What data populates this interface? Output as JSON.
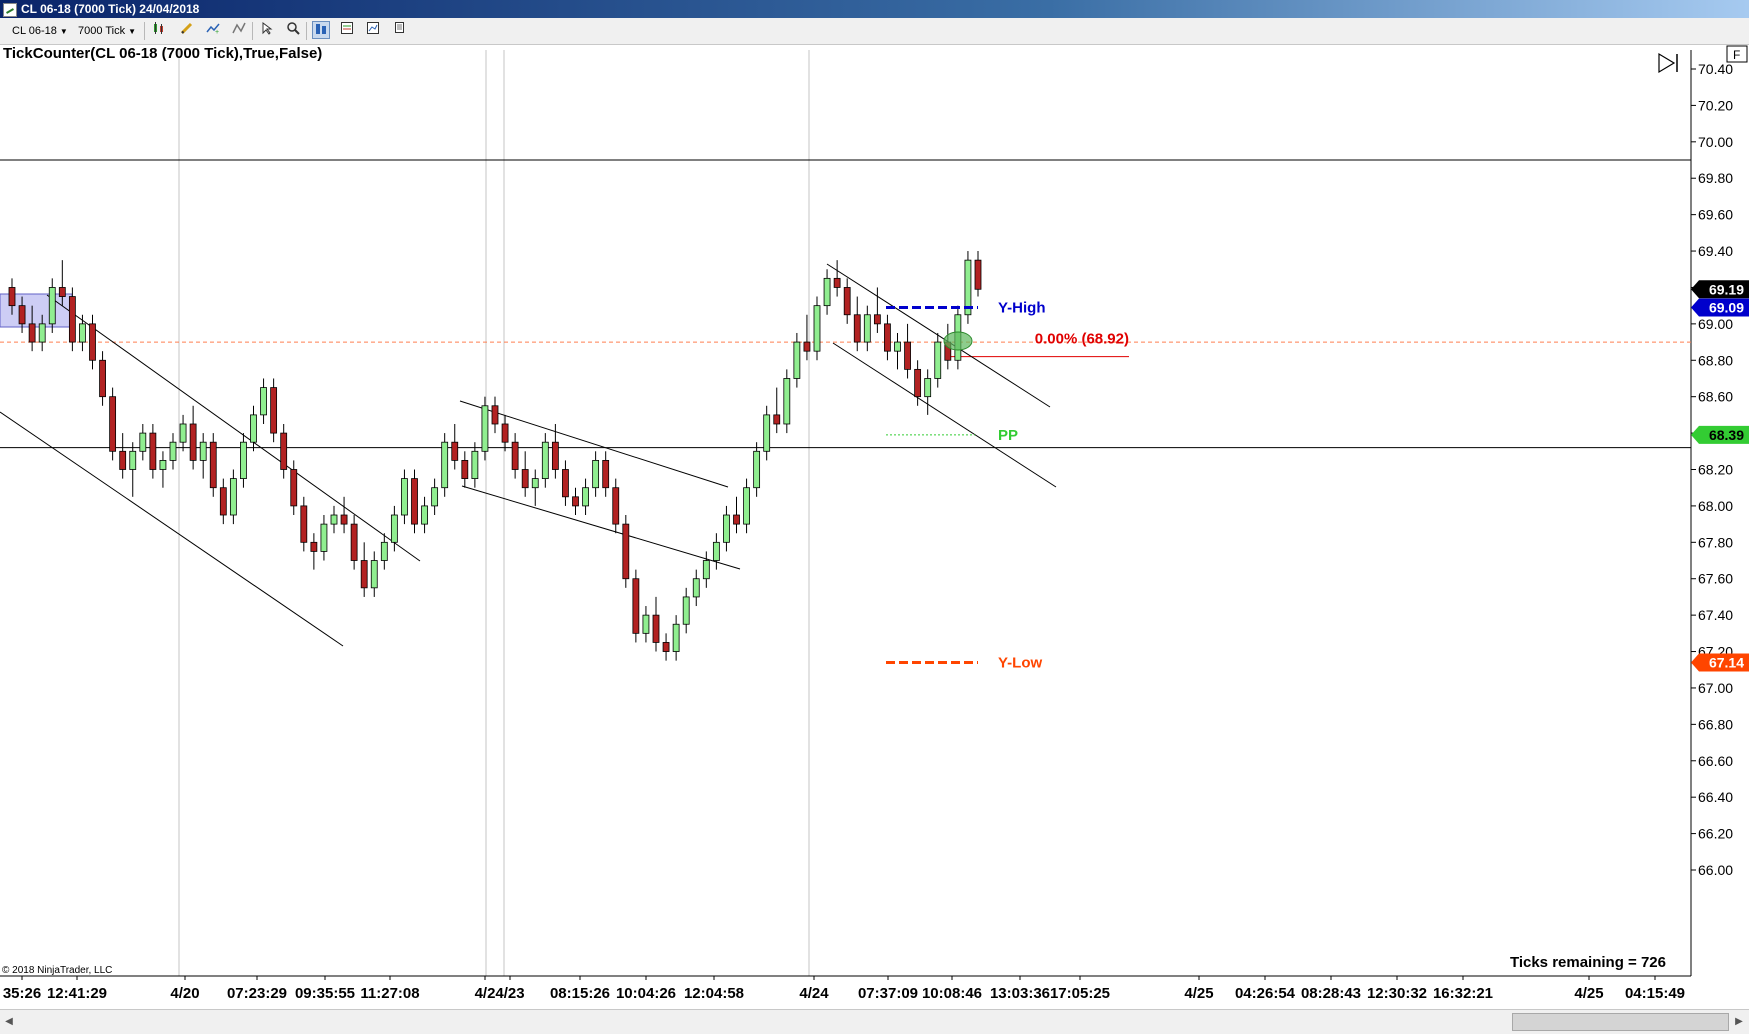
{
  "window": {
    "title": "CL 06-18 (7000 Tick)  24/04/2018"
  },
  "toolbar": {
    "instrument": "CL 06-18",
    "interval": "7000 Tick",
    "buttons": [
      {
        "name": "bar-type-icon"
      },
      {
        "name": "draw-pencil-icon"
      },
      {
        "name": "add-indicator-icon"
      },
      {
        "name": "strategy-icon"
      },
      {
        "name": "cursor-icon"
      },
      {
        "name": "zoom-icon"
      },
      {
        "name": "chart-trader-icon"
      },
      {
        "name": "data-box-icon"
      },
      {
        "name": "properties-icon"
      },
      {
        "name": "copy-icon"
      }
    ]
  },
  "chart": {
    "indicator_label": "TickCounter(CL 06-18 (7000 Tick),True,False)",
    "copyright": "© 2018 NinjaTrader, LLC",
    "ticks_remaining": "Ticks remaining = 726",
    "fib_label": "0.00% (68.92)",
    "y_high_label": "Y-High",
    "pp_label": "PP",
    "y_low_label": "Y-Low",
    "price_markers": [
      {
        "text": "69.19",
        "value": 69.19,
        "bg": "#000000",
        "fg": "#ffffff"
      },
      {
        "text": "69.09",
        "value": 69.09,
        "bg": "#0000cc",
        "fg": "#ffffff"
      },
      {
        "text": "68.39",
        "value": 68.39,
        "bg": "#33cc33",
        "fg": "#000000"
      },
      {
        "text": "67.14",
        "value": 67.14,
        "bg": "#ff4500",
        "fg": "#ffffff"
      }
    ],
    "colors": {
      "up_candle": "#90ee90",
      "down_candle": "#b22222",
      "y_high": "#0000cc",
      "pp": "#33cc33",
      "y_low": "#ff4500",
      "fib": "#e00000"
    }
  },
  "chart_data": {
    "type": "candlestick",
    "ylim": [
      66.0,
      70.5
    ],
    "y_ticks": [
      "70.40",
      "70.20",
      "70.00",
      "69.80",
      "69.60",
      "69.40",
      "69.20",
      "69.00",
      "68.80",
      "68.60",
      "68.40",
      "68.20",
      "68.00",
      "67.80",
      "67.60",
      "67.40",
      "67.20",
      "67.00",
      "66.80",
      "66.60",
      "66.40",
      "66.20",
      "66.00"
    ],
    "x_tick_labels": [
      "35:26",
      "12:41:29",
      "4/20",
      "07:23:29",
      "09:35:55",
      "11:27:08",
      "4/2",
      "4/23",
      "08:15:26",
      "10:04:26",
      "12:04:58",
      "4/24",
      "07:37:09",
      "10:08:46",
      "13:03:36",
      "17:05:25",
      "4/25",
      "04:26:54",
      "08:28:43",
      "12:30:32",
      "16:32:21",
      "4/25",
      "04:15:49"
    ],
    "levels": {
      "y_high": 69.09,
      "pp": 68.39,
      "y_low": 67.14,
      "fib_0": 68.92,
      "horizontal_line_upper": 69.9,
      "horizontal_line_lower": 68.32
    },
    "candles": [
      [
        69.2,
        69.25,
        69.05,
        69.1
      ],
      [
        69.1,
        69.15,
        68.95,
        69.0
      ],
      [
        69.0,
        69.1,
        68.85,
        68.9
      ],
      [
        68.9,
        69.05,
        68.85,
        69.0
      ],
      [
        69.0,
        69.25,
        68.95,
        69.2
      ],
      [
        69.2,
        69.35,
        69.1,
        69.15
      ],
      [
        69.15,
        69.2,
        68.85,
        68.9
      ],
      [
        68.9,
        69.05,
        68.85,
        69.0
      ],
      [
        69.0,
        69.05,
        68.75,
        68.8
      ],
      [
        68.8,
        68.85,
        68.55,
        68.6
      ],
      [
        68.6,
        68.65,
        68.25,
        68.3
      ],
      [
        68.3,
        68.4,
        68.15,
        68.2
      ],
      [
        68.2,
        68.35,
        68.05,
        68.3
      ],
      [
        68.3,
        68.45,
        68.25,
        68.4
      ],
      [
        68.4,
        68.45,
        68.15,
        68.2
      ],
      [
        68.2,
        68.3,
        68.1,
        68.25
      ],
      [
        68.25,
        68.4,
        68.2,
        68.35
      ],
      [
        68.35,
        68.5,
        68.3,
        68.45
      ],
      [
        68.45,
        68.55,
        68.2,
        68.25
      ],
      [
        68.25,
        68.4,
        68.15,
        68.35
      ],
      [
        68.35,
        68.4,
        68.05,
        68.1
      ],
      [
        68.1,
        68.15,
        67.9,
        67.95
      ],
      [
        67.95,
        68.2,
        67.9,
        68.15
      ],
      [
        68.15,
        68.4,
        68.1,
        68.35
      ],
      [
        68.35,
        68.55,
        68.3,
        68.5
      ],
      [
        68.5,
        68.7,
        68.45,
        68.65
      ],
      [
        68.65,
        68.7,
        68.35,
        68.4
      ],
      [
        68.4,
        68.45,
        68.15,
        68.2
      ],
      [
        68.2,
        68.25,
        67.95,
        68.0
      ],
      [
        68.0,
        68.05,
        67.75,
        67.8
      ],
      [
        67.8,
        67.85,
        67.65,
        67.75
      ],
      [
        67.75,
        67.95,
        67.7,
        67.9
      ],
      [
        67.9,
        68.0,
        67.85,
        67.95
      ],
      [
        67.95,
        68.05,
        67.85,
        67.9
      ],
      [
        67.9,
        67.95,
        67.65,
        67.7
      ],
      [
        67.7,
        67.8,
        67.5,
        67.55
      ],
      [
        67.55,
        67.75,
        67.5,
        67.7
      ],
      [
        67.7,
        67.85,
        67.65,
        67.8
      ],
      [
        67.8,
        68.0,
        67.75,
        67.95
      ],
      [
        67.95,
        68.2,
        67.9,
        68.15
      ],
      [
        68.15,
        68.2,
        67.85,
        67.9
      ],
      [
        67.9,
        68.05,
        67.85,
        68.0
      ],
      [
        68.0,
        68.15,
        67.95,
        68.1
      ],
      [
        68.1,
        68.4,
        68.05,
        68.35
      ],
      [
        68.35,
        68.45,
        68.2,
        68.25
      ],
      [
        68.25,
        68.3,
        68.1,
        68.15
      ],
      [
        68.15,
        68.35,
        68.1,
        68.3
      ],
      [
        68.3,
        68.6,
        68.25,
        68.55
      ],
      [
        68.55,
        68.6,
        68.4,
        68.45
      ],
      [
        68.45,
        68.5,
        68.3,
        68.35
      ],
      [
        68.35,
        68.4,
        68.15,
        68.2
      ],
      [
        68.2,
        68.3,
        68.05,
        68.1
      ],
      [
        68.1,
        68.2,
        68.0,
        68.15
      ],
      [
        68.15,
        68.4,
        68.1,
        68.35
      ],
      [
        68.35,
        68.45,
        68.15,
        68.2
      ],
      [
        68.2,
        68.25,
        68.0,
        68.05
      ],
      [
        68.05,
        68.1,
        67.95,
        68.0
      ],
      [
        68.0,
        68.15,
        67.95,
        68.1
      ],
      [
        68.1,
        68.3,
        68.05,
        68.25
      ],
      [
        68.25,
        68.3,
        68.05,
        68.1
      ],
      [
        68.1,
        68.15,
        67.85,
        67.9
      ],
      [
        67.9,
        67.95,
        67.55,
        67.6
      ],
      [
        67.6,
        67.65,
        67.25,
        67.3
      ],
      [
        67.3,
        67.45,
        67.25,
        67.4
      ],
      [
        67.4,
        67.5,
        67.2,
        67.25
      ],
      [
        67.25,
        67.3,
        67.15,
        67.2
      ],
      [
        67.2,
        67.4,
        67.15,
        67.35
      ],
      [
        67.35,
        67.55,
        67.3,
        67.5
      ],
      [
        67.5,
        67.65,
        67.45,
        67.6
      ],
      [
        67.6,
        67.75,
        67.55,
        67.7
      ],
      [
        67.7,
        67.85,
        67.65,
        67.8
      ],
      [
        67.8,
        68.0,
        67.75,
        67.95
      ],
      [
        67.95,
        68.05,
        67.85,
        67.9
      ],
      [
        67.9,
        68.15,
        67.85,
        68.1
      ],
      [
        68.1,
        68.35,
        68.05,
        68.3
      ],
      [
        68.3,
        68.55,
        68.25,
        68.5
      ],
      [
        68.5,
        68.65,
        68.4,
        68.45
      ],
      [
        68.45,
        68.75,
        68.4,
        68.7
      ],
      [
        68.7,
        68.95,
        68.65,
        68.9
      ],
      [
        68.9,
        69.05,
        68.8,
        68.85
      ],
      [
        68.85,
        69.15,
        68.8,
        69.1
      ],
      [
        69.1,
        69.3,
        69.05,
        69.25
      ],
      [
        69.25,
        69.35,
        69.15,
        69.2
      ],
      [
        69.2,
        69.25,
        69.0,
        69.05
      ],
      [
        69.05,
        69.15,
        68.85,
        68.9
      ],
      [
        68.9,
        69.1,
        68.85,
        69.05
      ],
      [
        69.05,
        69.2,
        68.95,
        69.0
      ],
      [
        69.0,
        69.05,
        68.8,
        68.85
      ],
      [
        68.85,
        68.95,
        68.75,
        68.9
      ],
      [
        68.9,
        69.0,
        68.7,
        68.75
      ],
      [
        68.75,
        68.8,
        68.55,
        68.6
      ],
      [
        68.6,
        68.75,
        68.5,
        68.7
      ],
      [
        68.7,
        68.95,
        68.65,
        68.9
      ],
      [
        68.9,
        69.0,
        68.75,
        68.8
      ],
      [
        68.8,
        69.1,
        68.75,
        69.05
      ],
      [
        69.05,
        69.4,
        69.0,
        69.35
      ],
      [
        69.35,
        69.4,
        69.15,
        69.19
      ]
    ]
  }
}
